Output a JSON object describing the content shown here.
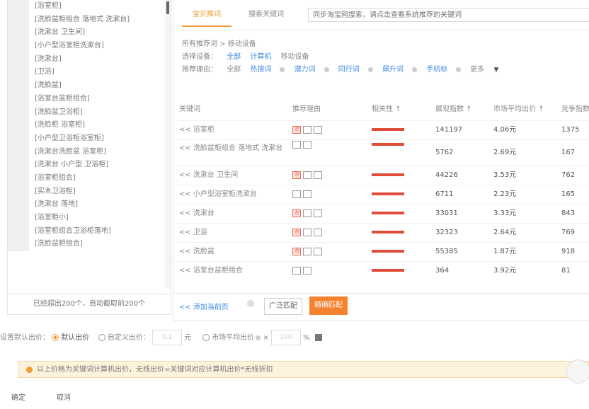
{
  "left_panel": {
    "items": [
      "[浴室柜]",
      "[洗脸盆柜组合 落地式 洗漱台]",
      "[洗漱台 卫生间]",
      "[小户型浴室柜洗漱台]",
      "[洗漱台]",
      "[卫浴]",
      "[洗脸盆]",
      "[浴室台盆柜组合]",
      "[洗脸盆卫浴柜]",
      "[洗脸柜 浴室柜]",
      "[小户型卫浴柜浴室柜]",
      "[洗漱台洗脸盆 浴室柜]",
      "[洗漱台 小户型 卫浴柜]",
      "[浴室柜组合]",
      "[实木卫浴柜]",
      "[洗漱台 落地]",
      "[浴室柜小]",
      "[浴室柜组合卫浴柜落地]",
      "[洗脸盆柜组合]"
    ],
    "footer": "已经超出200个，自动截取前200个"
  },
  "tabs": {
    "recommend": "宝贝推词",
    "search": "搜索关键词"
  },
  "search": {
    "placeholder": "同步淘宝网搜索，请点击查看系统推荐的关键词"
  },
  "filters": {
    "breadcrumb": "所有推荐词 >  移动设备",
    "device_label": "选择设备：",
    "device_all": "全部",
    "device_pc": "计算机",
    "device_mobile": "移动设备",
    "reason_label": "推荐理由：",
    "reason_all": "全部",
    "reason_hot": "热搜词",
    "reason_potential": "潜力词",
    "reason_peer": "同行词",
    "reason_rise": "飙升词",
    "reason_mobile": "手机标",
    "more": "更多"
  },
  "table": {
    "headers": {
      "keyword": "关键词",
      "reason": "推荐理由",
      "relevance": "相关性 ↑",
      "show": "展现指数 ↑",
      "price": "市场平均出价 ↑",
      "competition": "竞争指数 ↑"
    },
    "rows": [
      {
        "keyword": "<< 浴室柜",
        "hot": true,
        "show": "141197",
        "price": "4.06元",
        "competition": "1375"
      },
      {
        "keyword": "<< 洗脸盆柜组合 落地式 洗漱台",
        "hot": false,
        "show": "5762",
        "price": "2.69元",
        "competition": "167"
      },
      {
        "keyword": "<< 洗漱台 卫生间",
        "hot": true,
        "show": "44226",
        "price": "3.53元",
        "competition": "762"
      },
      {
        "keyword": "<< 小户型浴室柜洗漱台",
        "hot": false,
        "show": "6711",
        "price": "2.23元",
        "competition": "165"
      },
      {
        "keyword": "<< 洗漱台",
        "hot": true,
        "show": "33031",
        "price": "3.33元",
        "competition": "843"
      },
      {
        "keyword": "<< 卫浴",
        "hot": true,
        "show": "32323",
        "price": "2.64元",
        "competition": "769"
      },
      {
        "keyword": "<< 洗脸盆",
        "hot": true,
        "show": "55385",
        "price": "1.87元",
        "competition": "918"
      },
      {
        "keyword": "<< 浴室台盆柜组合",
        "hot": false,
        "show": "364",
        "price": "3.92元",
        "competition": "81"
      }
    ]
  },
  "actions": {
    "add_page": "<< 添加当前页",
    "broad": "广泛匹配",
    "exact": "精确匹配"
  },
  "price_row": {
    "label": "设置默认出价：",
    "default": "默认出价",
    "custom": "自定义出价：",
    "custom_value": "0.1",
    "yuan": "元",
    "market": "市场平均出价",
    "times": "×",
    "pct_value": "100",
    "pct": "%"
  },
  "notice": "以上价格为关键词计算机出价，无线出价=关键词对应计算机出价*无线折扣",
  "buttons": {
    "ok": "确定",
    "cancel": "取消"
  }
}
